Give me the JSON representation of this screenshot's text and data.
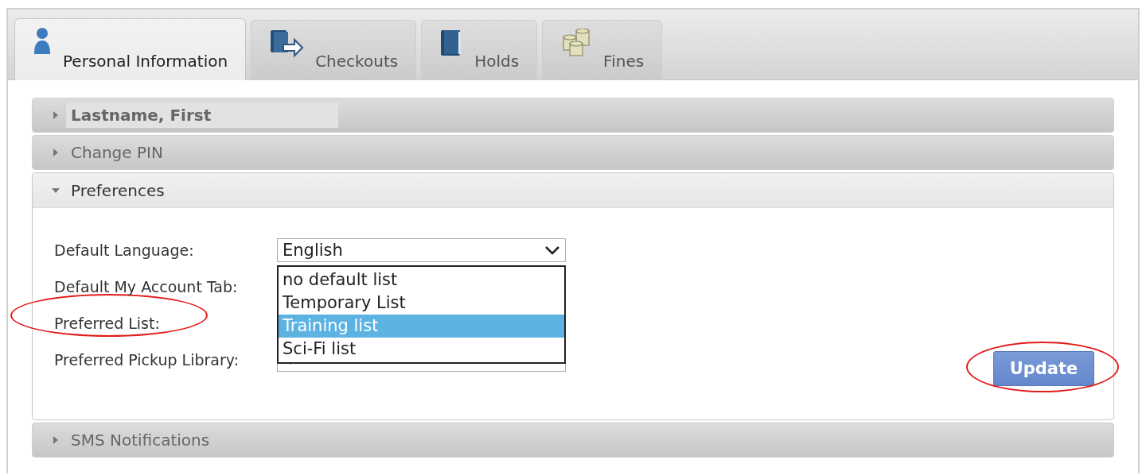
{
  "tabs": [
    {
      "label": "Personal Information",
      "kind": "person",
      "selected": true
    },
    {
      "label": "Checkouts",
      "kind": "checkout",
      "selected": false
    },
    {
      "label": "Holds",
      "kind": "book",
      "selected": false
    },
    {
      "label": "Fines",
      "kind": "coins",
      "selected": false
    }
  ],
  "sections": [
    {
      "title": "Lastname, First",
      "expanded": false,
      "shaded_title": true
    },
    {
      "title": "Change PIN",
      "expanded": false,
      "shaded_title": false
    },
    {
      "title": "Preferences",
      "expanded": true,
      "shaded_title": false,
      "form": {
        "fields": [
          {
            "label": "Default Language:",
            "value": "English",
            "circled": false
          },
          {
            "label": "Default My Account Tab:",
            "circled": false
          },
          {
            "label": "Preferred List:",
            "circled": true,
            "open": true,
            "options": [
              {
                "label": "no default list",
                "selected": false
              },
              {
                "label": "Temporary List",
                "selected": false
              },
              {
                "label": "Training list",
                "selected": true
              },
              {
                "label": "Sci-Fi list",
                "selected": false
              }
            ]
          },
          {
            "label": "Preferred Pickup Library:",
            "circled": false
          }
        ],
        "button": {
          "label": "Update",
          "circled": true
        }
      }
    },
    {
      "title": "SMS Notifications",
      "expanded": false,
      "shaded_title": false
    }
  ]
}
